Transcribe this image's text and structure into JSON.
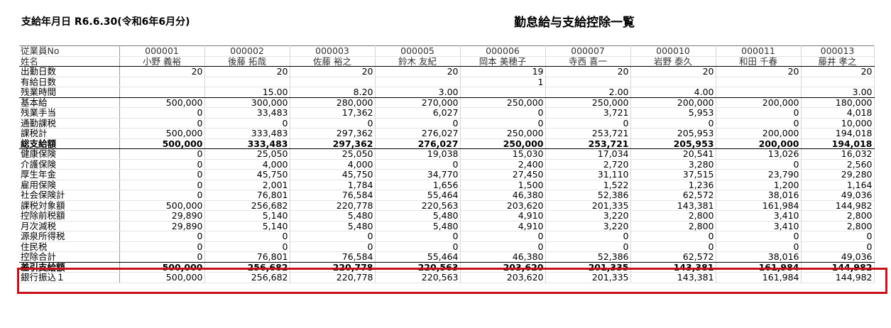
{
  "header": {
    "pay_date": "支給年月日 R6.6.30(令和6年6月分)",
    "report_title": "勤怠給与支給控除一覧"
  },
  "table": {
    "employee_no_label": "従業員No",
    "name_label": "姓名",
    "employee_numbers": [
      "000001",
      "000002",
      "000003",
      "000005",
      "000006",
      "000007",
      "000010",
      "000011",
      "000013"
    ],
    "names": [
      "小野 義裕",
      "後藤 拓哉",
      "佐藤 裕之",
      "鈴木 友紀",
      "岡本 美穂子",
      "寺西 喜一",
      "岩野 泰久",
      "和田 千春",
      "藤井 孝之"
    ],
    "rows": [
      {
        "label": "出勤日数",
        "values": [
          "20",
          "20",
          "20",
          "20",
          "19",
          "20",
          "20",
          "20",
          "20"
        ]
      },
      {
        "label": "有給日数",
        "values": [
          "",
          "",
          "",
          "",
          "1",
          "",
          "",
          "",
          ""
        ]
      },
      {
        "label": "残業時間",
        "values": [
          "",
          "15.00",
          "8.20",
          "3.00",
          "",
          "2.00",
          "4.00",
          "",
          "3.00"
        ]
      },
      {
        "label": "基本給",
        "values": [
          "500,000",
          "300,000",
          "280,000",
          "270,000",
          "250,000",
          "250,000",
          "200,000",
          "200,000",
          "180,000"
        ]
      },
      {
        "label": "残業手当",
        "values": [
          "0",
          "33,483",
          "17,362",
          "6,027",
          "0",
          "3,721",
          "5,953",
          "0",
          "4,018"
        ]
      },
      {
        "label": "通勤課税",
        "values": [
          "0",
          "0",
          "0",
          "0",
          "0",
          "0",
          "0",
          "0",
          "10,000"
        ]
      },
      {
        "label": "課税計",
        "values": [
          "500,000",
          "333,483",
          "297,362",
          "276,027",
          "250,000",
          "253,721",
          "205,953",
          "200,000",
          "194,018"
        ]
      },
      {
        "label": "総支給額",
        "values": [
          "500,000",
          "333,483",
          "297,362",
          "276,027",
          "250,000",
          "253,721",
          "205,953",
          "200,000",
          "194,018"
        ]
      },
      {
        "label": "健康保険",
        "values": [
          "0",
          "25,050",
          "25,050",
          "19,038",
          "15,030",
          "17,034",
          "20,541",
          "13,026",
          "16,032"
        ]
      },
      {
        "label": "介護保険",
        "values": [
          "0",
          "4,000",
          "4,000",
          "0",
          "2,400",
          "2,720",
          "3,280",
          "0",
          "2,560"
        ]
      },
      {
        "label": "厚生年金",
        "values": [
          "0",
          "45,750",
          "45,750",
          "34,770",
          "27,450",
          "31,110",
          "37,515",
          "23,790",
          "29,280"
        ]
      },
      {
        "label": "雇用保険",
        "values": [
          "0",
          "2,001",
          "1,784",
          "1,656",
          "1,500",
          "1,522",
          "1,236",
          "1,200",
          "1,164"
        ]
      },
      {
        "label": "社会保険計",
        "values": [
          "0",
          "76,801",
          "76,584",
          "55,464",
          "46,380",
          "52,386",
          "62,572",
          "38,016",
          "49,036"
        ]
      },
      {
        "label": "課税対象額",
        "values": [
          "500,000",
          "256,682",
          "220,778",
          "220,563",
          "203,620",
          "201,335",
          "143,381",
          "161,984",
          "144,982"
        ]
      },
      {
        "label": "控除前税額",
        "values": [
          "29,890",
          "5,140",
          "5,480",
          "5,480",
          "4,910",
          "3,220",
          "2,800",
          "3,410",
          "2,800"
        ]
      },
      {
        "label": "月次減税",
        "values": [
          "29,890",
          "5,140",
          "5,480",
          "5,480",
          "4,910",
          "3,220",
          "2,800",
          "3,410",
          "2,800"
        ]
      },
      {
        "label": "源泉所得税",
        "values": [
          "0",
          "0",
          "0",
          "0",
          "0",
          "0",
          "0",
          "0",
          "0"
        ]
      },
      {
        "label": "住民税",
        "values": [
          "0",
          "0",
          "0",
          "0",
          "0",
          "0",
          "0",
          "0",
          "0"
        ]
      },
      {
        "label": "控除合計",
        "values": [
          "0",
          "76,801",
          "76,584",
          "55,464",
          "46,380",
          "52,386",
          "62,572",
          "38,016",
          "49,036"
        ]
      },
      {
        "label": "差引支給額",
        "values": [
          "500,000",
          "256,682",
          "220,778",
          "220,563",
          "203,620",
          "201,335",
          "143,381",
          "161,984",
          "144,982"
        ]
      },
      {
        "label": "銀行振込１",
        "values": [
          "500,000",
          "256,682",
          "220,778",
          "220,563",
          "203,620",
          "201,335",
          "143,381",
          "161,984",
          "144,982"
        ]
      }
    ]
  }
}
